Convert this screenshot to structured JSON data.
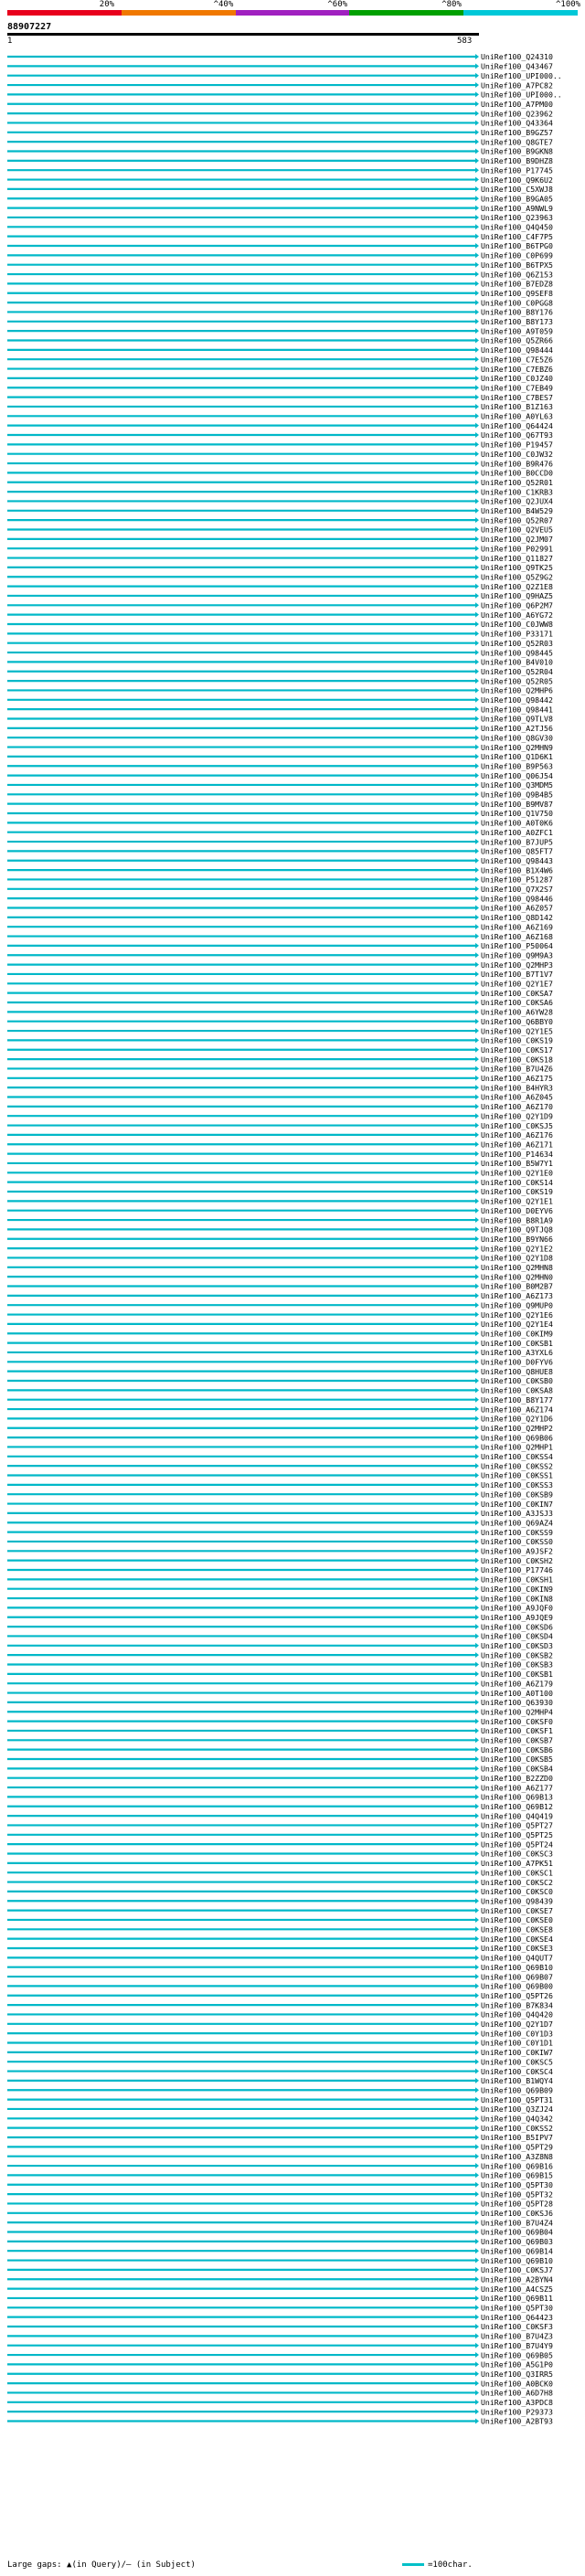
{
  "legend": {
    "labels": [
      "20%",
      "^40%",
      "^60%",
      "^80%",
      "^100%"
    ],
    "colors": [
      "#e8001c",
      "#f07800",
      "#a020c0",
      "#00a000",
      "#00c8d8"
    ]
  },
  "query_id": "88907227",
  "query_start": "1",
  "query_end": "583",
  "footer": {
    "large_gaps": "Large gaps: ▲(in Query)/– (in Subject)",
    "scale": "=100char."
  },
  "chart_data": {
    "type": "alignment-overview",
    "query_length": 583,
    "hits": [
      "UniRef100_Q24310",
      "UniRef100_Q43467",
      "UniRef100_UPI000..",
      "UniRef100_A7PC82",
      "UniRef100_UPI000..",
      "UniRef100_A7PM00",
      "UniRef100_Q23962",
      "UniRef100_Q43364",
      "UniRef100_B9GZ57",
      "UniRef100_Q8GTE7",
      "UniRef100_B9GKN8",
      "UniRef100_B9DHZ8",
      "UniRef100_P17745",
      "UniRef100_Q9K6U2",
      "UniRef100_C5XWJ8",
      "UniRef100_B9GA05",
      "UniRef100_A9NWL9",
      "UniRef100_Q23963",
      "UniRef100_Q4Q450",
      "UniRef100_C4F7P5",
      "UniRef100_B6TPG0",
      "UniRef100_C0P699",
      "UniRef100_B6TPX5",
      "UniRef100_Q6Z153",
      "UniRef100_B7EDZ8",
      "UniRef100_Q9SEF8",
      "UniRef100_C0PGG8",
      "UniRef100_B8Y176",
      "UniRef100_B8Y173",
      "UniRef100_A9T059",
      "UniRef100_Q5ZR66",
      "UniRef100_Q98444",
      "UniRef100_C7E5Z6",
      "UniRef100_C7EBZ6",
      "UniRef100_C0JZ40",
      "UniRef100_C7EB49",
      "UniRef100_C7BES7",
      "UniRef100_B1Z163",
      "UniRef100_A0YL63",
      "UniRef100_Q64424",
      "UniRef100_Q67T93",
      "UniRef100_P19457",
      "UniRef100_C0JW32",
      "UniRef100_B9R476",
      "UniRef100_B0CCD0",
      "UniRef100_Q52R01",
      "UniRef100_C1KRB3",
      "UniRef100_Q2JUX4",
      "UniRef100_B4W529",
      "UniRef100_Q52R07",
      "UniRef100_Q2VEU5",
      "UniRef100_Q2JM07",
      "UniRef100_P02991",
      "UniRef100_Q11827",
      "UniRef100_Q9TK25",
      "UniRef100_Q5Z9G2",
      "UniRef100_Q2Z1E8",
      "UniRef100_Q9HAZ5",
      "UniRef100_Q6P2M7",
      "UniRef100_A6YG72",
      "UniRef100_C0JWW8",
      "UniRef100_P33171",
      "UniRef100_Q52R03",
      "UniRef100_Q98445",
      "UniRef100_B4V010",
      "UniRef100_Q52R04",
      "UniRef100_Q52R05",
      "UniRef100_Q2MHP6",
      "UniRef100_Q98442",
      "UniRef100_Q98441",
      "UniRef100_Q9TLV8",
      "UniRef100_A2TJ56",
      "UniRef100_Q8GV30",
      "UniRef100_Q2MHN9",
      "UniRef100_Q1D6K1",
      "UniRef100_B9P563",
      "UniRef100_Q06J54",
      "UniRef100_Q3MDM5",
      "UniRef100_Q9B4B5",
      "UniRef100_B9MV87",
      "UniRef100_Q1V750",
      "UniRef100_A0T0K6",
      "UniRef100_A0ZFC1",
      "UniRef100_B7JUP5",
      "UniRef100_Q85FT7",
      "UniRef100_Q98443",
      "UniRef100_B1X4W6",
      "UniRef100_P51287",
      "UniRef100_Q7X2S7",
      "UniRef100_Q98446",
      "UniRef100_A6Z057",
      "UniRef100_Q8D142",
      "UniRef100_A6Z169",
      "UniRef100_A6Z168",
      "UniRef100_P50064",
      "UniRef100_Q9M9A3",
      "UniRef100_Q2MHP3",
      "UniRef100_B7T1V7",
      "UniRef100_Q2Y1E7",
      "UniRef100_C0KSA7",
      "UniRef100_C0KSA6",
      "UniRef100_A6YW28",
      "UniRef100_Q6BBY0",
      "UniRef100_Q2Y1E5",
      "UniRef100_C0KS19",
      "UniRef100_C0KS17",
      "UniRef100_C0KS18",
      "UniRef100_B7U4Z6",
      "UniRef100_A6Z175",
      "UniRef100_B4HYR3",
      "UniRef100_A6Z045",
      "UniRef100_A6Z170",
      "UniRef100_Q2Y1D9",
      "UniRef100_C0KSJ5",
      "UniRef100_A6Z176",
      "UniRef100_A6Z171",
      "UniRef100_P14634",
      "UniRef100_B5W7Y1",
      "UniRef100_Q2Y1E0",
      "UniRef100_C0KS14",
      "UniRef100_C0KS19",
      "UniRef100_Q2Y1E1",
      "UniRef100_D0EYV6",
      "UniRef100_B8R1A9",
      "UniRef100_Q9TJQ8",
      "UniRef100_B9YN66",
      "UniRef100_Q2Y1E2",
      "UniRef100_Q2Y1D8",
      "UniRef100_Q2MHN8",
      "UniRef100_Q2MHN0",
      "UniRef100_B0M2B7",
      "UniRef100_A6Z173",
      "UniRef100_Q9MUP0",
      "UniRef100_Q2Y1E6",
      "UniRef100_Q2Y1E4",
      "UniRef100_C0KIM9",
      "UniRef100_C0KSB1",
      "UniRef100_A3YXL6",
      "UniRef100_D0FYV6",
      "UniRef100_Q8HUE8",
      "UniRef100_C0KSB0",
      "UniRef100_C0KSA8",
      "UniRef100_B8Y177",
      "UniRef100_A6Z174",
      "UniRef100_Q2Y1D6",
      "UniRef100_Q2MHP2",
      "UniRef100_Q69B06",
      "UniRef100_Q2MHP1",
      "UniRef100_C0KSS4",
      "UniRef100_C0KSS2",
      "UniRef100_C0KSS1",
      "UniRef100_C0KSS3",
      "UniRef100_C0KSB9",
      "UniRef100_C0KIN7",
      "UniRef100_A3JSJ3",
      "UniRef100_Q69AZ4",
      "UniRef100_C0KSS9",
      "UniRef100_C0KSS0",
      "UniRef100_A9JSF2",
      "UniRef100_C0KSH2",
      "UniRef100_P17746",
      "UniRef100_C0KSH1",
      "UniRef100_C0KIN9",
      "UniRef100_C0KIN8",
      "UniRef100_A9JQF0",
      "UniRef100_A9JQE9",
      "UniRef100_C0KSD6",
      "UniRef100_C0KSD4",
      "UniRef100_C0KSD3",
      "UniRef100_C0KSB2",
      "UniRef100_C0KSB3",
      "UniRef100_C0KSB1",
      "UniRef100_A6Z179",
      "UniRef100_A0T100",
      "UniRef100_Q63930",
      "UniRef100_Q2MHP4",
      "UniRef100_C0KSF0",
      "UniRef100_C0KSF1",
      "UniRef100_C0KSB7",
      "UniRef100_C0KSB6",
      "UniRef100_C0KSB5",
      "UniRef100_C0KSB4",
      "UniRef100_B2ZZD0",
      "UniRef100_A6Z177",
      "UniRef100_Q69B13",
      "UniRef100_Q69B12",
      "UniRef100_Q4Q419",
      "UniRef100_Q5PT27",
      "UniRef100_Q5PT25",
      "UniRef100_Q5PT24",
      "UniRef100_C0KSC3",
      "UniRef100_A7PK51",
      "UniRef100_C0KSC1",
      "UniRef100_C0KSC2",
      "UniRef100_C0KSC0",
      "UniRef100_Q98439",
      "UniRef100_C0KSE7",
      "UniRef100_C0KSE0",
      "UniRef100_C0KSE8",
      "UniRef100_C0KSE4",
      "UniRef100_C0KSE3",
      "UniRef100_Q4QUT7",
      "UniRef100_Q69B10",
      "UniRef100_Q69B07",
      "UniRef100_Q69B00",
      "UniRef100_Q5PT26",
      "UniRef100_B7K834",
      "UniRef100_Q4Q420",
      "UniRef100_Q2Y1D7",
      "UniRef100_C0Y1D3",
      "UniRef100_C0Y1D1",
      "UniRef100_C0KIW7",
      "UniRef100_C0KSC5",
      "UniRef100_C0KSC4",
      "UniRef100_B1WQY4",
      "UniRef100_Q69B09",
      "UniRef100_Q5PT31",
      "UniRef100_Q3ZJ24",
      "UniRef100_Q4Q342",
      "UniRef100_C0KSS2",
      "UniRef100_B5IPV7",
      "UniRef100_Q5PT29",
      "UniRef100_A3Z8N8",
      "UniRef100_Q69B16",
      "UniRef100_Q69B15",
      "UniRef100_Q5PT30",
      "UniRef100_Q5PT32",
      "UniRef100_Q5PT28",
      "UniRef100_C0KSJ6",
      "UniRef100_B7U4Z4",
      "UniRef100_Q69B04",
      "UniRef100_Q69B03",
      "UniRef100_Q69B14",
      "UniRef100_Q69B10",
      "UniRef100_C0KSJ7",
      "UniRef100_A2BYN4",
      "UniRef100_A4CSZ5",
      "UniRef100_Q69B11",
      "UniRef100_Q5PT30",
      "UniRef100_Q64423",
      "UniRef100_C0KSF3",
      "UniRef100_B7U4Z3",
      "UniRef100_B7U4Y9",
      "UniRef100_Q69B05",
      "UniRef100_A5G1P0",
      "UniRef100_Q3IRR5",
      "UniRef100_A0BCK0",
      "UniRef100_A6D7H8",
      "UniRef100_A3PDC8",
      "UniRef100_P29373",
      "UniRef100_A2BT93"
    ]
  }
}
